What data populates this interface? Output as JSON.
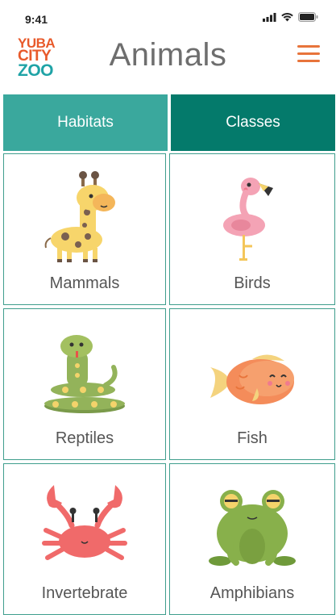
{
  "status_bar": {
    "time": "9:41"
  },
  "header": {
    "logo": {
      "line1": "YUBA",
      "line2": "CITY",
      "line3": "ZOO"
    },
    "title": "Animals",
    "menu_icon": "hamburger-menu-icon"
  },
  "tabs": [
    {
      "label": "Habitats",
      "active": false
    },
    {
      "label": "Classes",
      "active": true
    }
  ],
  "categories": [
    {
      "label": "Mammals",
      "icon": "giraffe-icon"
    },
    {
      "label": "Birds",
      "icon": "flamingo-icon"
    },
    {
      "label": "Reptiles",
      "icon": "snake-icon"
    },
    {
      "label": "Fish",
      "icon": "fish-icon"
    },
    {
      "label": "Invertebrate",
      "icon": "crab-icon"
    },
    {
      "label": "Amphibians",
      "icon": "frog-icon"
    }
  ],
  "colors": {
    "tab_habitats": "#3aa89d",
    "tab_classes": "#047a6b",
    "card_border": "#3f9e8d",
    "menu": "#e8743b",
    "logo_orange": "#e85a2b",
    "logo_teal": "#1fa3a6"
  }
}
